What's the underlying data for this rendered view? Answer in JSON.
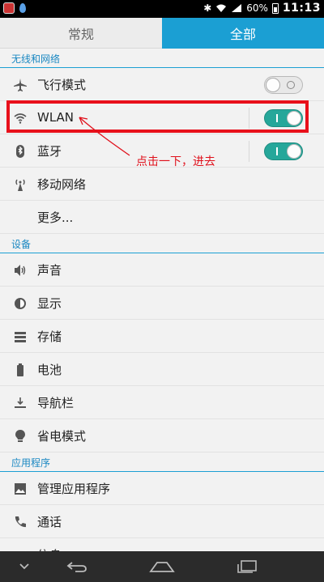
{
  "status_bar": {
    "battery": "60%",
    "time": "11:13"
  },
  "tabs": [
    {
      "label": "常规",
      "active": false
    },
    {
      "label": "全部",
      "active": true
    }
  ],
  "sections": {
    "wireless": {
      "header": "无线和网络",
      "items": {
        "airplane": {
          "label": "飞行模式",
          "icon": "airplane-icon",
          "toggle": "off"
        },
        "wlan": {
          "label": "WLAN",
          "icon": "wifi-icon",
          "toggle": "on"
        },
        "bluetooth": {
          "label": "蓝牙",
          "icon": "bluetooth-icon",
          "toggle": "on"
        },
        "mobile": {
          "label": "移动网络",
          "icon": "antenna-icon"
        },
        "more": {
          "label": "更多..."
        }
      }
    },
    "device": {
      "header": "设备",
      "items": {
        "sound": {
          "label": "声音",
          "icon": "speaker-icon"
        },
        "display": {
          "label": "显示",
          "icon": "brightness-icon"
        },
        "storage": {
          "label": "存储",
          "icon": "storage-icon"
        },
        "battery": {
          "label": "电池",
          "icon": "battery-icon"
        },
        "navbar": {
          "label": "导航栏",
          "icon": "download-bar-icon"
        },
        "power_saving": {
          "label": "省电模式",
          "icon": "bulb-icon"
        }
      }
    },
    "apps": {
      "header": "应用程序",
      "items": {
        "manage_apps": {
          "label": "管理应用程序",
          "icon": "image-app-icon"
        },
        "call": {
          "label": "通话",
          "icon": "phone-icon"
        },
        "messages": {
          "label": "信息",
          "icon": "mail-icon"
        }
      }
    }
  },
  "annotation": {
    "text": "点击一下，进去",
    "color": "#e8101b"
  },
  "colors": {
    "accent": "#1b9fd3",
    "toggle_on": "#26a79a"
  }
}
